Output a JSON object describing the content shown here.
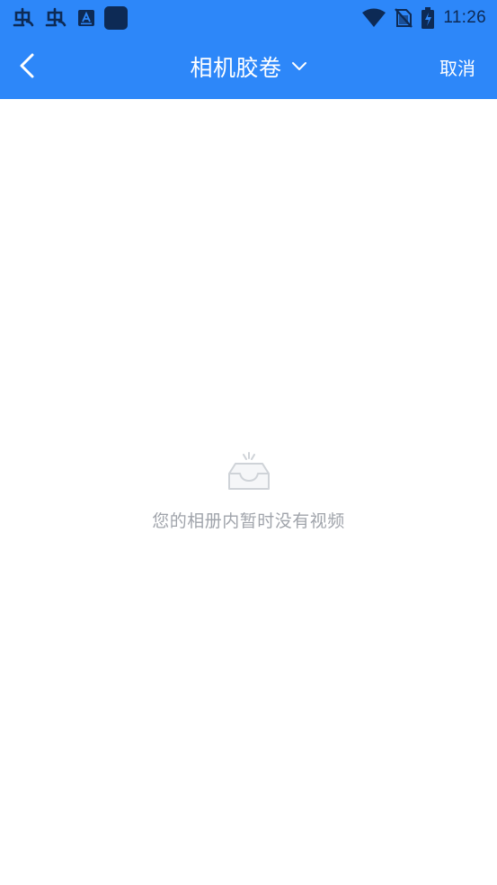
{
  "status_bar": {
    "time": "11:26",
    "left_icons": [
      "bug-icon",
      "bug-icon",
      "text-app-icon",
      "app-square-icon"
    ],
    "right_icons": [
      "wifi-icon",
      "no-sim-icon",
      "battery-charging-icon"
    ],
    "icon_color": "#0d2a55"
  },
  "header": {
    "title": "相机胶卷",
    "cancel_label": "取消",
    "background_color": "#2d87f9"
  },
  "empty_state": {
    "message": "您的相册内暂时没有视频"
  }
}
